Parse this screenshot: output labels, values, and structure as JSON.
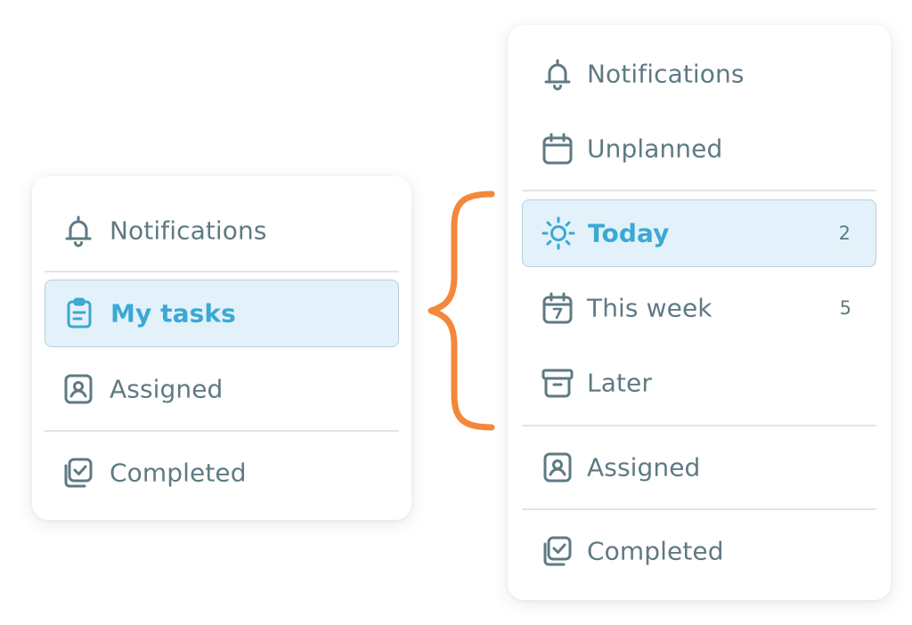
{
  "left_panel": {
    "items": [
      {
        "label": "Notifications",
        "icon": "bell-icon"
      },
      {
        "label": "My tasks",
        "icon": "clipboard-icon",
        "active": true
      },
      {
        "label": "Assigned",
        "icon": "user-card-icon"
      },
      {
        "label": "Completed",
        "icon": "completed-check-icon"
      }
    ]
  },
  "right_panel": {
    "items": [
      {
        "label": "Notifications",
        "icon": "bell-icon"
      },
      {
        "label": "Unplanned",
        "icon": "calendar-icon"
      },
      {
        "label": "Today",
        "icon": "sun-icon",
        "count": "2",
        "active": true
      },
      {
        "label": "This week",
        "icon": "calendar-7-icon",
        "count": "5"
      },
      {
        "label": "Later",
        "icon": "archive-box-icon"
      },
      {
        "label": "Assigned",
        "icon": "user-card-icon"
      },
      {
        "label": "Completed",
        "icon": "completed-check-icon"
      }
    ]
  },
  "colors": {
    "text": "#5e7a83",
    "accent": "#3aa9d3",
    "active_bg": "#e3f1fb",
    "active_border": "#b5cfd9",
    "divider": "#dfe6e9",
    "brace": "#f5873a"
  }
}
